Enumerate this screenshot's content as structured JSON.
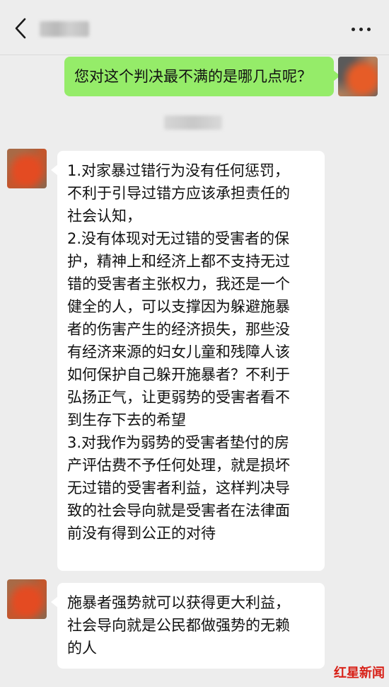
{
  "header": {
    "contact_name_blurred": "",
    "back_icon": "chevron-left-icon",
    "more_icon": "more-dots-icon"
  },
  "messages": [
    {
      "sender": "self",
      "text": "您对这个判决最不满的是哪几点呢？",
      "bubble_color": "#95ec69"
    },
    {
      "sender": "other",
      "text": "1.对家暴过错行为没有任何惩罚，\n不利于引导过错方应该承担责任的\n社会认知，\n2.没有体现对无过错的受害者的保\n护，精神上和经济上都不支持无过\n错的受害者主张权力，我还是一个\n健全的人，可以支撑因为躲避施暴\n者的伤害产生的经济损失，那些没\n有经济来源的妇女儿童和残障人该\n如何保护自己躲开施暴者？不利于\n弘扬正气，让更弱势的受害者看不\n到生存下去的希望\n3.对我作为弱势的受害者垫付的房\n产评估费不予任何处理，就是损坏\n无过错的受害者利益，这样判决导\n致的社会导向就是受害者在法律面\n前没有得到公正的对待",
      "bubble_color": "#ffffff"
    },
    {
      "sender": "other",
      "text": "施暴者强势就可以获得更大利益，\n社会导向就是公民都做强势的无赖\n的人",
      "bubble_color": "#ffffff"
    }
  ],
  "watermark": {
    "text": "红星新闻",
    "color": "#d82118"
  },
  "colors": {
    "background": "#ededed",
    "self_bubble": "#95ec69",
    "other_bubble": "#ffffff"
  }
}
